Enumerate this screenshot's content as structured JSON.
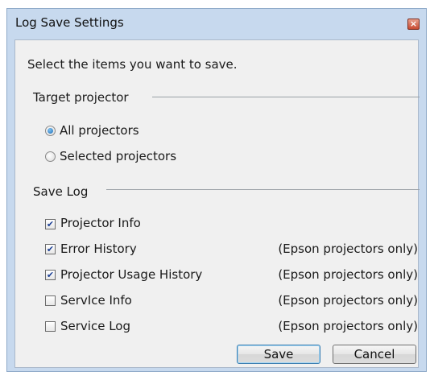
{
  "dialog": {
    "title": "Log Save Settings",
    "close_glyph": "×"
  },
  "instruction": "Select the items you want to save.",
  "target_group": {
    "label": "Target projector",
    "options": [
      {
        "label": "All projectors",
        "selected": true
      },
      {
        "label": "Selected projectors",
        "selected": false
      }
    ]
  },
  "log_group": {
    "label": "Save Log",
    "items": [
      {
        "label": "Projector Info",
        "checked": true,
        "note": ""
      },
      {
        "label": "Error History",
        "checked": true,
        "note": "(Epson projectors only)"
      },
      {
        "label": "Projector Usage History",
        "checked": true,
        "note": "(Epson projectors only)"
      },
      {
        "label": "ServIce Info",
        "checked": false,
        "note": "(Epson projectors only)"
      },
      {
        "label": "Service Log",
        "checked": false,
        "note": "(Epson projectors only)"
      }
    ]
  },
  "buttons": {
    "save": "Save",
    "cancel": "Cancel"
  },
  "check_glyph": "✔"
}
